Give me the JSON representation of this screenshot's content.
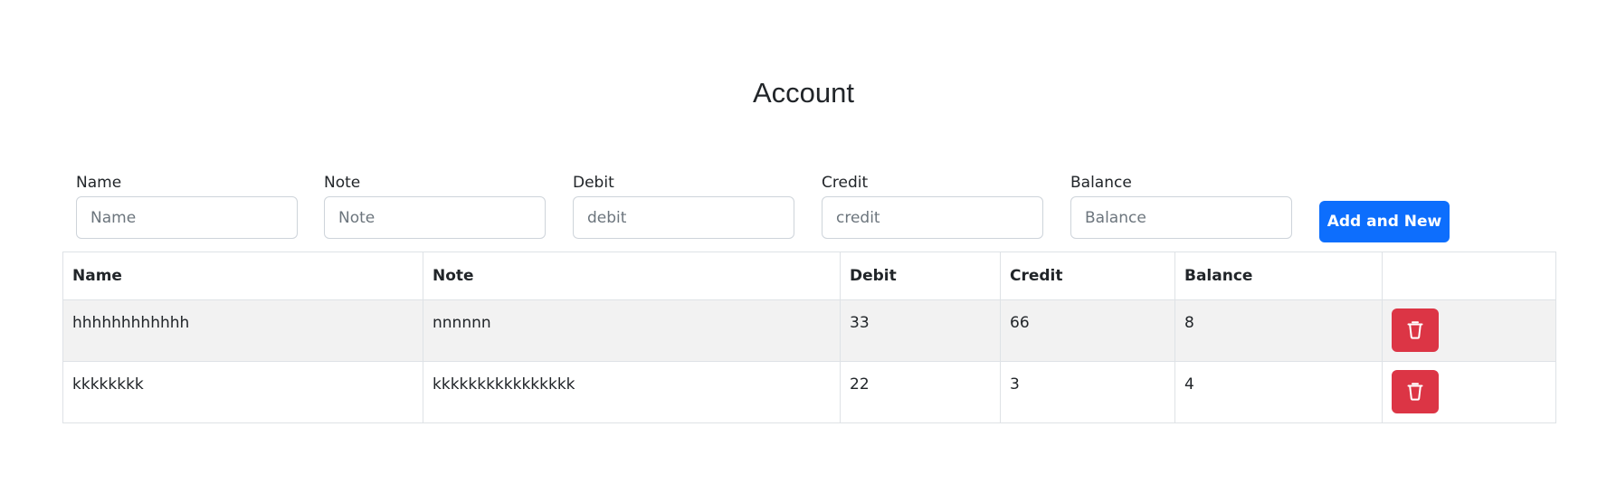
{
  "page": {
    "title": "Account"
  },
  "form": {
    "fields": [
      {
        "label": "Name",
        "placeholder": "Name",
        "value": ""
      },
      {
        "label": "Note",
        "placeholder": "Note",
        "value": ""
      },
      {
        "label": "Debit",
        "placeholder": "debit",
        "value": ""
      },
      {
        "label": "Credit",
        "placeholder": "credit",
        "value": ""
      },
      {
        "label": "Balance",
        "placeholder": "Balance",
        "value": ""
      }
    ],
    "submit_label": "Add and New"
  },
  "table": {
    "headers": [
      "Name",
      "Note",
      "Debit",
      "Credit",
      "Balance",
      ""
    ],
    "rows": [
      {
        "name": "hhhhhhhhhhhh",
        "note": "nnnnnn",
        "debit": "33",
        "credit": "66",
        "balance": "8",
        "action_icon": "trash-icon"
      },
      {
        "name": "kkkkkkkk",
        "note": "kkkkkkkkkkkkkkkk",
        "debit": "22",
        "credit": "3",
        "balance": "4",
        "action_icon": "trash-icon"
      }
    ]
  },
  "colors": {
    "primary": "#0d6efd",
    "danger": "#dc3545",
    "stripe": "#f2f2f2",
    "border": "#dee2e6"
  }
}
